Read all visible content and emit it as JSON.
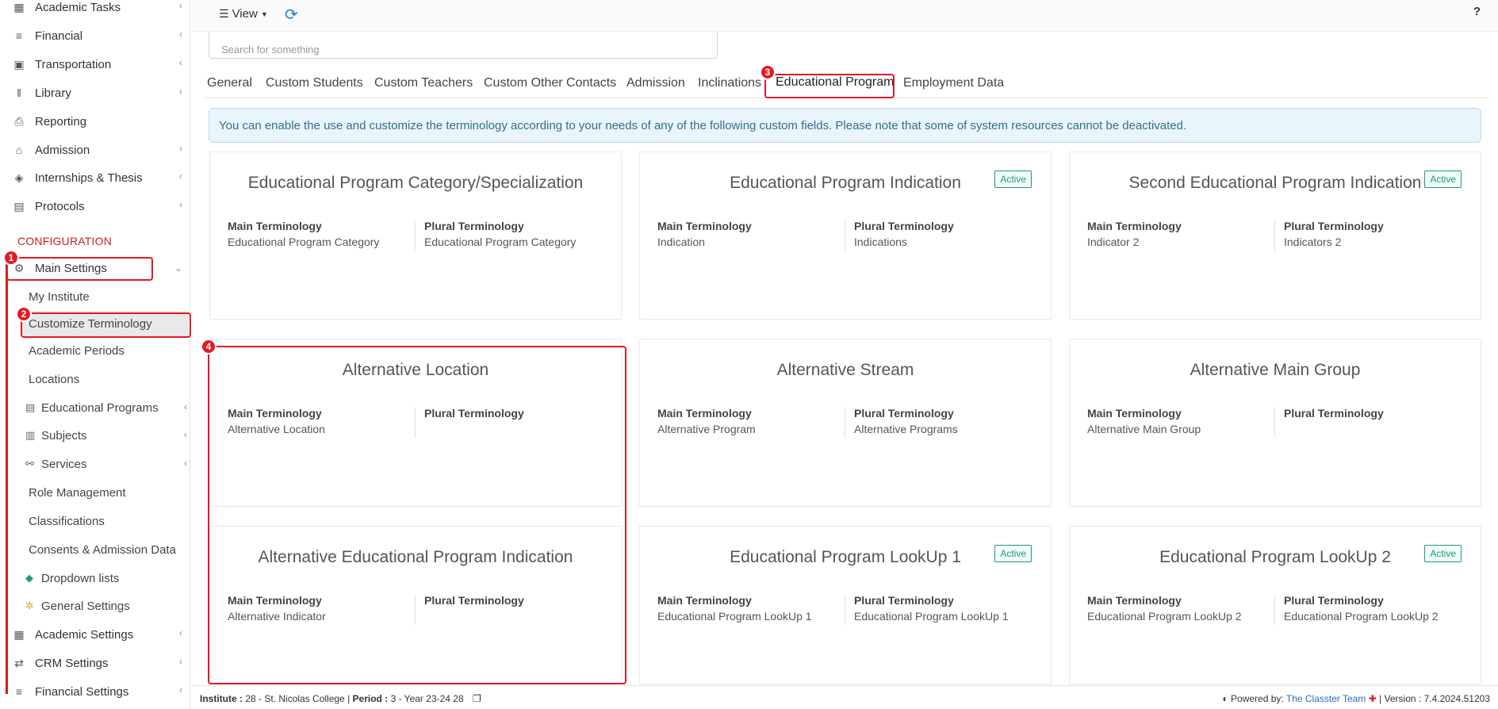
{
  "sidebar": {
    "top_items": [
      {
        "label": "Academic Tasks",
        "icon": "grid-icon"
      },
      {
        "label": "Financial",
        "icon": "coins-icon"
      },
      {
        "label": "Transportation",
        "icon": "bus-icon"
      },
      {
        "label": "Library",
        "icon": "books-icon"
      },
      {
        "label": "Reporting",
        "icon": "printer-icon"
      },
      {
        "label": "Admission",
        "icon": "institution-icon"
      },
      {
        "label": "Internships & Thesis",
        "icon": "box-icon"
      },
      {
        "label": "Protocols",
        "icon": "fax-icon"
      }
    ],
    "config_label": "CONFIGURATION",
    "main_settings": "Main Settings",
    "sub_items": [
      "My Institute",
      "Customize Terminology",
      "Academic Periods",
      "Locations",
      "Educational Programs",
      "Subjects",
      "Services",
      "Role Management",
      "Classifications",
      "Consents & Admission Data",
      "Dropdown lists",
      "General Settings"
    ],
    "bottom_items": [
      {
        "label": "Academic Settings"
      },
      {
        "label": "CRM Settings"
      },
      {
        "label": "Financial Settings"
      }
    ],
    "step_badges": [
      "1",
      "2"
    ]
  },
  "topbar": {
    "view_label": "View",
    "help_label": "?"
  },
  "search": {
    "placeholder": "Search for something"
  },
  "tabs": [
    "General",
    "Custom Students",
    "Custom Teachers",
    "Custom Other Contacts",
    "Admission",
    "Inclinations",
    "Educational Program",
    "Employment Data"
  ],
  "active_tab": "Educational Program",
  "step_badges": [
    "3",
    "4"
  ],
  "info_text": "You can enable the use and customize the terminology according to your needs of any of the following custom fields. Please note that some of system resources cannot be deactivated.",
  "labels": {
    "main": "Main Terminology",
    "plural": "Plural Terminology",
    "active": "Active"
  },
  "cards": [
    {
      "title": "Educational Program Category/Specialization",
      "main": "Educational Program Category",
      "plural": "Educational Program Category",
      "active": false
    },
    {
      "title": "Educational Program Indication",
      "main": "Indication",
      "plural": "Indications",
      "active": true
    },
    {
      "title": "Second Educational Program Indication",
      "main": "Indicator 2",
      "plural": "Indicators 2",
      "active": true
    },
    {
      "title": "Alternative Location",
      "main": "Alternative Location",
      "plural": "",
      "active": false
    },
    {
      "title": "Alternative Stream",
      "main": "Alternative Program",
      "plural": "Alternative Programs",
      "active": false
    },
    {
      "title": "Alternative Main Group",
      "main": "Alternative Main Group",
      "plural": "",
      "active": false
    },
    {
      "title": "Alternative Educational Program Indication",
      "main": "Alternative Indicator",
      "plural": "",
      "active": false
    },
    {
      "title": "Educational Program LookUp 1",
      "main": "Educational Program LookUp 1",
      "plural": "Educational Program LookUp 1",
      "active": true
    },
    {
      "title": "Educational Program LookUp 2",
      "main": "Educational Program LookUp 2",
      "plural": "Educational Program LookUp 2",
      "active": true
    }
  ],
  "footer": {
    "institute_label": "Institute :",
    "institute_value": "28 - St. Nicolas College",
    "sep": "|",
    "period_label": "Period :",
    "period_value": "3 - Year 23-24 28",
    "powered_by": "Powered by:",
    "team": "The Classter Team",
    "version": "| Version : 7.4.2024.51203"
  },
  "colors": {
    "accent_red": "#e01b24",
    "link_blue": "#2d6cb5",
    "active_green": "#1d9a7b"
  }
}
